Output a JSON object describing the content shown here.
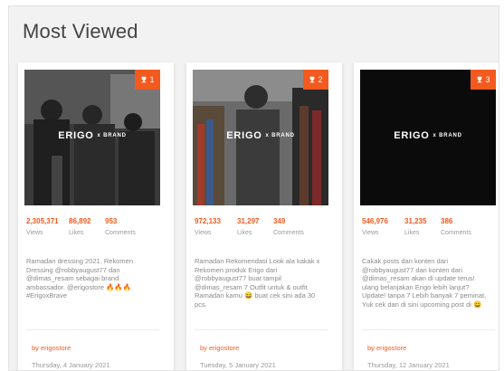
{
  "section": {
    "title": "Most Viewed"
  },
  "cards": [
    {
      "rank": "1",
      "logo_text": "ERIGO",
      "logo_small": "x BRAND",
      "views": "2,305,371",
      "likes": "86,892",
      "comments": "953",
      "labels": {
        "views": "Views",
        "likes": "Likes",
        "comments": "Comments"
      },
      "caption": "Ramadan dressing 2021. Rekomen Dressing @robbyaugust77 dan @dimas_resam sebagai brand ambassador. @erigostore ",
      "caption_emoji": "🔥🔥🔥",
      "caption_tail": " #ErigoxBrave",
      "author": "by erigostore",
      "date": "Thursday, 4 January 2021"
    },
    {
      "rank": "2",
      "logo_text": "ERIGO",
      "logo_small": "x BRAND",
      "views": "972,133",
      "likes": "31,297",
      "comments": "349",
      "labels": {
        "views": "Views",
        "likes": "Likes",
        "comments": "Comments"
      },
      "caption": "Ramadan Rekomendasi Look ala kakak x Rekomen produk Erigo dari @robbyaugust77 buat tampil @dimas_resam 7 Outfit untuk & outfit Ramadan kamu ",
      "caption_emoji": "😀",
      "caption_tail": " buat cek sini ada 30 pcs.",
      "author": "by erigostore",
      "date": "Tuesday, 5 January 2021"
    },
    {
      "rank": "3",
      "logo_text": "ERIGO",
      "logo_small": "x BRAND",
      "views": "546,976",
      "likes": "31,235",
      "comments": "386",
      "labels": {
        "views": "Views",
        "likes": "Likes",
        "comments": "Comments"
      },
      "caption": "Cakak posts dan konten dari @robbyaugust77 dan konten dari @dimas_resam akan di update terus! ulang belanjakan Erigo lebih lanjut? Update! tanpa 7 Lebih banyak 7 peminat, Yuk cek dan di sini upcoming post di ",
      "caption_emoji": "😀",
      "caption_tail": "",
      "author": "by erigostore",
      "date": "Thursday, 12 January 2021"
    }
  ]
}
